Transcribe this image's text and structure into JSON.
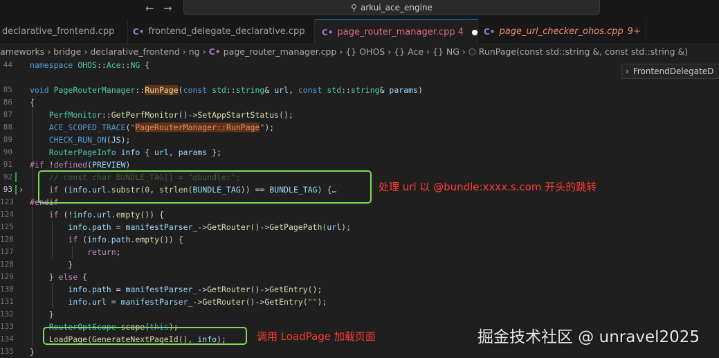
{
  "window": {
    "title": "arkui_ace_engine"
  },
  "tabs": [
    {
      "label": "declarative_frontend.cpp",
      "icon": "",
      "badge": ""
    },
    {
      "label": "frontend_delegate_declarative.cpp",
      "icon": "C•",
      "badge": ""
    },
    {
      "label": "page_router_manager.cpp 4",
      "icon": "C•",
      "badge": ""
    },
    {
      "label": "page_url_checker_ohos.cpp",
      "icon": "C•",
      "badge": "9+"
    }
  ],
  "breadcrumb": {
    "p1": "ameworks",
    "p2": "bridge",
    "p3": "declarative_frontend",
    "p4": "ng",
    "file": "page_router_manager.cpp",
    "ns1": "OHOS",
    "ns2": "Ace",
    "ns3": "NG",
    "fn": "RunPage(const std::string &, const std::string &)",
    "sep": "›",
    "ns_icon": "{}",
    "cpp_icon": "C•",
    "fn_icon": "⬡"
  },
  "hover": {
    "chevron": "›",
    "label": "FrontendDelegateD"
  },
  "code": {
    "lines": [
      {
        "num": "44",
        "parts": [
          [
            "kw",
            "namespace "
          ],
          [
            "ty",
            "OHOS"
          ],
          [
            "pun",
            "::"
          ],
          [
            "ty",
            "Ace"
          ],
          [
            "pun",
            "::"
          ],
          [
            "ty",
            "NG"
          ],
          [
            "pun",
            " {"
          ]
        ]
      },
      {
        "num": "",
        "parts": []
      },
      {
        "num": "85",
        "parts": [
          [
            "kw",
            "void "
          ],
          [
            "ty",
            "PageRouterManager"
          ],
          [
            "pun",
            "::"
          ],
          [
            "fn hl",
            "RunPage"
          ],
          [
            "pun",
            "("
          ],
          [
            "kw",
            "const "
          ],
          [
            "ty",
            "std"
          ],
          [
            "pun",
            "::"
          ],
          [
            "ty",
            "string"
          ],
          [
            "pun",
            "& "
          ],
          [
            "var",
            "url"
          ],
          [
            "pun",
            ", "
          ],
          [
            "kw",
            "const "
          ],
          [
            "ty",
            "std"
          ],
          [
            "pun",
            "::"
          ],
          [
            "ty",
            "string"
          ],
          [
            "pun",
            "& "
          ],
          [
            "var",
            "params"
          ],
          [
            "pun",
            ")"
          ]
        ]
      },
      {
        "num": "86",
        "parts": [
          [
            "pun",
            "{"
          ]
        ]
      },
      {
        "num": "87",
        "parts": [
          [
            "pun",
            "    "
          ],
          [
            "ty",
            "PerfMonitor"
          ],
          [
            "pun",
            "::"
          ],
          [
            "fn",
            "GetPerfMonitor"
          ],
          [
            "pun",
            "()->"
          ],
          [
            "fn",
            "SetAppStartStatus"
          ],
          [
            "pun",
            "();"
          ]
        ]
      },
      {
        "num": "88",
        "parts": [
          [
            "pun",
            "    "
          ],
          [
            "mac",
            "ACE_SCOPED_TRACE"
          ],
          [
            "pun",
            "("
          ],
          [
            "str",
            "\""
          ],
          [
            "str hl",
            "PageRouterManager::RunPage"
          ],
          [
            "str",
            "\""
          ],
          [
            "pun",
            ");"
          ]
        ]
      },
      {
        "num": "89",
        "parts": [
          [
            "pun",
            "    "
          ],
          [
            "mac",
            "CHECK_RUN_ON"
          ],
          [
            "pun",
            "("
          ],
          [
            "var",
            "JS"
          ],
          [
            "pun",
            ");"
          ]
        ]
      },
      {
        "num": "90",
        "parts": [
          [
            "pun",
            "    "
          ],
          [
            "ty",
            "RouterPageInfo "
          ],
          [
            "var",
            "info"
          ],
          [
            "pun",
            " { "
          ],
          [
            "var",
            "url"
          ],
          [
            "pun",
            ", "
          ],
          [
            "var",
            "params"
          ],
          [
            "pun",
            " };"
          ]
        ]
      },
      {
        "num": "91",
        "parts": [
          [
            "kw2",
            "#if "
          ],
          [
            "pun",
            "!"
          ],
          [
            "kw2",
            "defined"
          ],
          [
            "pun",
            "("
          ],
          [
            "var",
            "PREVIEW"
          ],
          [
            "pun",
            ")"
          ]
        ]
      },
      {
        "num": "92",
        "parts": [
          [
            "cm dim",
            "    // const char BUNDLE_TAG[] = \"@bundle:\";"
          ]
        ]
      },
      {
        "num": "93",
        "parts": [
          [
            "pun",
            "    "
          ],
          [
            "kw2",
            "if"
          ],
          [
            "pun",
            " ("
          ],
          [
            "var",
            "info"
          ],
          [
            "pun",
            "."
          ],
          [
            "var",
            "url"
          ],
          [
            "pun",
            "."
          ],
          [
            "fn",
            "substr"
          ],
          [
            "pun",
            "("
          ],
          [
            "num",
            "0"
          ],
          [
            "pun",
            ", "
          ],
          [
            "fn",
            "strlen"
          ],
          [
            "pun",
            "("
          ],
          [
            "var",
            "BUNDLE_TAG"
          ],
          [
            "pun",
            ")) == "
          ],
          [
            "var",
            "BUNDLE_TAG"
          ],
          [
            "pun",
            ") {…"
          ]
        ]
      },
      {
        "num": "123",
        "parts": [
          [
            "kw2",
            "#endif"
          ]
        ]
      },
      {
        "num": "124",
        "parts": [
          [
            "pun",
            "    "
          ],
          [
            "kw2",
            "if"
          ],
          [
            "pun",
            " (!"
          ],
          [
            "var",
            "info"
          ],
          [
            "pun",
            "."
          ],
          [
            "var",
            "url"
          ],
          [
            "pun",
            "."
          ],
          [
            "fn",
            "empty"
          ],
          [
            "pun",
            "()) {"
          ]
        ]
      },
      {
        "num": "125",
        "parts": [
          [
            "pun",
            "        "
          ],
          [
            "var",
            "info"
          ],
          [
            "pun",
            "."
          ],
          [
            "var",
            "path"
          ],
          [
            "pun",
            " = "
          ],
          [
            "var",
            "manifestParser_"
          ],
          [
            "pun",
            "->"
          ],
          [
            "fn",
            "GetRouter"
          ],
          [
            "pun",
            "()->"
          ],
          [
            "fn",
            "GetPagePath"
          ],
          [
            "pun",
            "("
          ],
          [
            "var",
            "url"
          ],
          [
            "pun",
            ");"
          ]
        ]
      },
      {
        "num": "126",
        "parts": [
          [
            "pun",
            "        "
          ],
          [
            "kw2",
            "if"
          ],
          [
            "pun",
            " ("
          ],
          [
            "var",
            "info"
          ],
          [
            "pun",
            "."
          ],
          [
            "var",
            "path"
          ],
          [
            "pun",
            "."
          ],
          [
            "fn",
            "empty"
          ],
          [
            "pun",
            "()) {"
          ]
        ]
      },
      {
        "num": "127",
        "parts": [
          [
            "pun",
            "            "
          ],
          [
            "kw2",
            "return"
          ],
          [
            "pun",
            ";"
          ]
        ]
      },
      {
        "num": "128",
        "parts": [
          [
            "pun",
            "        }"
          ]
        ]
      },
      {
        "num": "129",
        "parts": [
          [
            "pun",
            "    } "
          ],
          [
            "kw2",
            "else"
          ],
          [
            "pun",
            " {"
          ]
        ]
      },
      {
        "num": "130",
        "parts": [
          [
            "pun",
            "        "
          ],
          [
            "var",
            "info"
          ],
          [
            "pun",
            "."
          ],
          [
            "var",
            "path"
          ],
          [
            "pun",
            " = "
          ],
          [
            "var",
            "manifestParser_"
          ],
          [
            "pun",
            "->"
          ],
          [
            "fn",
            "GetRouter"
          ],
          [
            "pun",
            "()->"
          ],
          [
            "fn",
            "GetEntry"
          ],
          [
            "pun",
            "();"
          ]
        ]
      },
      {
        "num": "131",
        "parts": [
          [
            "pun",
            "        "
          ],
          [
            "var",
            "info"
          ],
          [
            "pun",
            "."
          ],
          [
            "var",
            "url"
          ],
          [
            "pun",
            " = "
          ],
          [
            "var",
            "manifestParser_"
          ],
          [
            "pun",
            "->"
          ],
          [
            "fn",
            "GetRouter"
          ],
          [
            "pun",
            "()->"
          ],
          [
            "fn",
            "GetEntry"
          ],
          [
            "pun",
            "("
          ],
          [
            "str",
            "\"\""
          ],
          [
            "pun",
            ");"
          ]
        ]
      },
      {
        "num": "132",
        "parts": [
          [
            "pun",
            "    }"
          ]
        ]
      },
      {
        "num": "133",
        "parts": [
          [
            "pun",
            "    "
          ],
          [
            "ty",
            "RouterOptScope "
          ],
          [
            "fn",
            "scope"
          ],
          [
            "pun",
            "("
          ],
          [
            "kw",
            "this"
          ],
          [
            "pun",
            ");"
          ]
        ]
      },
      {
        "num": "134",
        "parts": [
          [
            "pun",
            "    "
          ],
          [
            "fn",
            "LoadPage"
          ],
          [
            "pun",
            "("
          ],
          [
            "fn",
            "GenerateNextPageId"
          ],
          [
            "pun",
            "(), "
          ],
          [
            "var",
            "info"
          ],
          [
            "pun",
            ");"
          ]
        ]
      },
      {
        "num": "135",
        "parts": [
          [
            "pun",
            "}"
          ]
        ]
      }
    ],
    "current_line": "93"
  },
  "annotations": {
    "bundle_text": "处理 url 以 @bundle:xxxx.s.com 开头的跳转",
    "loadpage_text": "调用 LoadPage 加载页面",
    "box_color": "#7ed957",
    "text_color": "#ff3b30"
  },
  "watermark": "掘金技术社区 @ unravel2025",
  "colors": {
    "accent": "#0078d4",
    "modified_tab": "#e06c75",
    "error_tab": "#f48771"
  }
}
